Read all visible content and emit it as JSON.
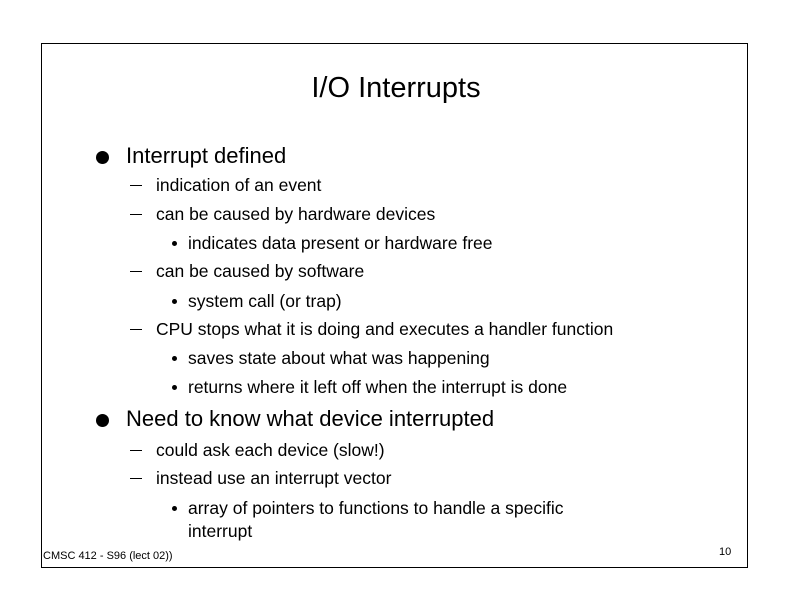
{
  "slide": {
    "title": "I/O Interrupts",
    "items": [
      {
        "level": 1,
        "text": "Interrupt defined"
      },
      {
        "level": 2,
        "text": "indication of an event"
      },
      {
        "level": 2,
        "text": "can be caused by hardware devices"
      },
      {
        "level": 3,
        "text": "indicates data present or hardware free"
      },
      {
        "level": 2,
        "text": "can be caused by software"
      },
      {
        "level": 3,
        "text": "system call (or trap)"
      },
      {
        "level": 2,
        "text": "CPU stops what it is doing and executes a handler function"
      },
      {
        "level": 3,
        "text": "saves state about what was happening"
      },
      {
        "level": 3,
        "text": "returns where it left off when the interrupt is done"
      },
      {
        "level": 1,
        "text": "Need to know what device interrupted"
      },
      {
        "level": 2,
        "text": "could ask each device (slow!)"
      },
      {
        "level": 2,
        "text": "instead use an interrupt vector"
      },
      {
        "level": 3,
        "text": "array of pointers to functions to handle a specific",
        "continuation": "interrupt"
      }
    ],
    "footer": {
      "course": "CMSC 412 - S96  (lect 02))",
      "page_number": "10"
    }
  }
}
